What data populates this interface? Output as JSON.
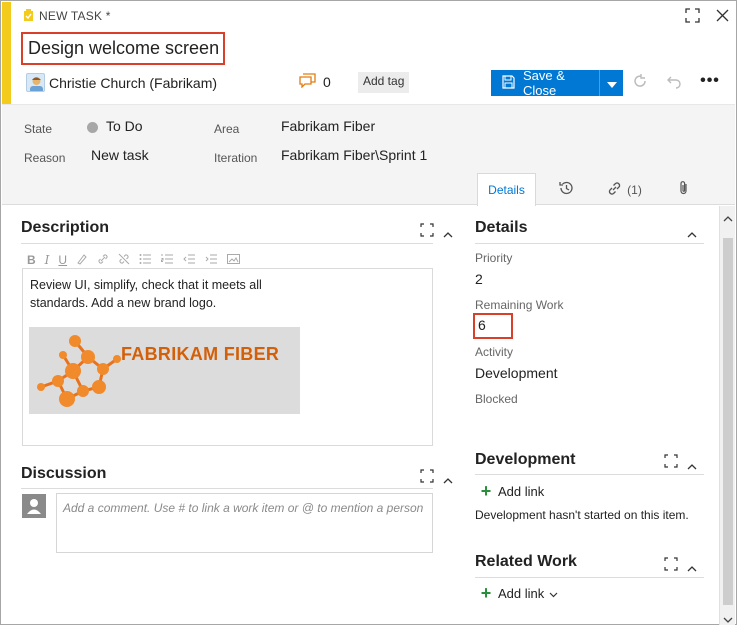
{
  "window": {
    "task_label": "NEW TASK *",
    "title": "Design welcome screen"
  },
  "header": {
    "owner": "Christie Church (Fabrikam)",
    "comment_count": "0",
    "add_tag": "Add tag",
    "save_close": "Save & Close"
  },
  "fields": {
    "state_label": "State",
    "state_value": "To Do",
    "reason_label": "Reason",
    "reason_value": "New task",
    "area_label": "Area",
    "area_value": "Fabrikam Fiber",
    "iteration_label": "Iteration",
    "iteration_value": "Fabrikam Fiber\\Sprint 1"
  },
  "tabs": [
    {
      "label": "Details",
      "icon": "",
      "selected": true
    },
    {
      "label": "",
      "icon": "history-icon",
      "selected": false
    },
    {
      "label": "(1)",
      "icon": "link-icon",
      "selected": false
    },
    {
      "label": "",
      "icon": "paperclip-icon",
      "selected": false
    }
  ],
  "description": {
    "title": "Description",
    "text": "Review UI, simplify, check that it meets all standards. Add a new brand logo.",
    "image_text": "FABRIKAM FIBER"
  },
  "discussion": {
    "title": "Discussion",
    "placeholder": "Add a comment. Use # to link a work item or @ to mention a person"
  },
  "details": {
    "title": "Details",
    "priority_label": "Priority",
    "priority_value": "2",
    "remaining_label": "Remaining Work",
    "remaining_value": "6",
    "activity_label": "Activity",
    "activity_value": "Development",
    "blocked_label": "Blocked"
  },
  "development": {
    "title": "Development",
    "add_link": "Add link",
    "status": "Development hasn't started on this item."
  },
  "related": {
    "title": "Related Work",
    "add_link": "Add link"
  },
  "colors": {
    "accent": "#f2cb1d",
    "primary": "#0078d4",
    "highlight": "#d9402b",
    "brand_orange": "#d35f08",
    "add_green": "#2a8f3a"
  }
}
